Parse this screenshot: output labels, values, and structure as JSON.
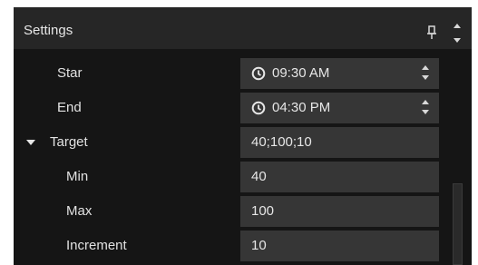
{
  "panel": {
    "title": "Settings",
    "pin_icon": "pin-icon",
    "scroll_icons": [
      "chevron-up-icon",
      "chevron-down-icon"
    ]
  },
  "properties": {
    "start": {
      "label": "Star",
      "value": "09:30 AM",
      "icon": "clock-icon"
    },
    "end": {
      "label": "End",
      "value": "04:30 PM",
      "icon": "clock-icon"
    },
    "target": {
      "label": "Target",
      "value": "40;100;10",
      "expanded": true,
      "children": {
        "min": {
          "label": "Min",
          "value": "40"
        },
        "max": {
          "label": "Max",
          "value": "100"
        },
        "increment": {
          "label": "Increment",
          "value": "10"
        }
      }
    }
  },
  "colors": {
    "panel_bg": "#151515",
    "titlebar_bg": "#262626",
    "field_bg": "#363636",
    "text": "#e6e6e6"
  }
}
